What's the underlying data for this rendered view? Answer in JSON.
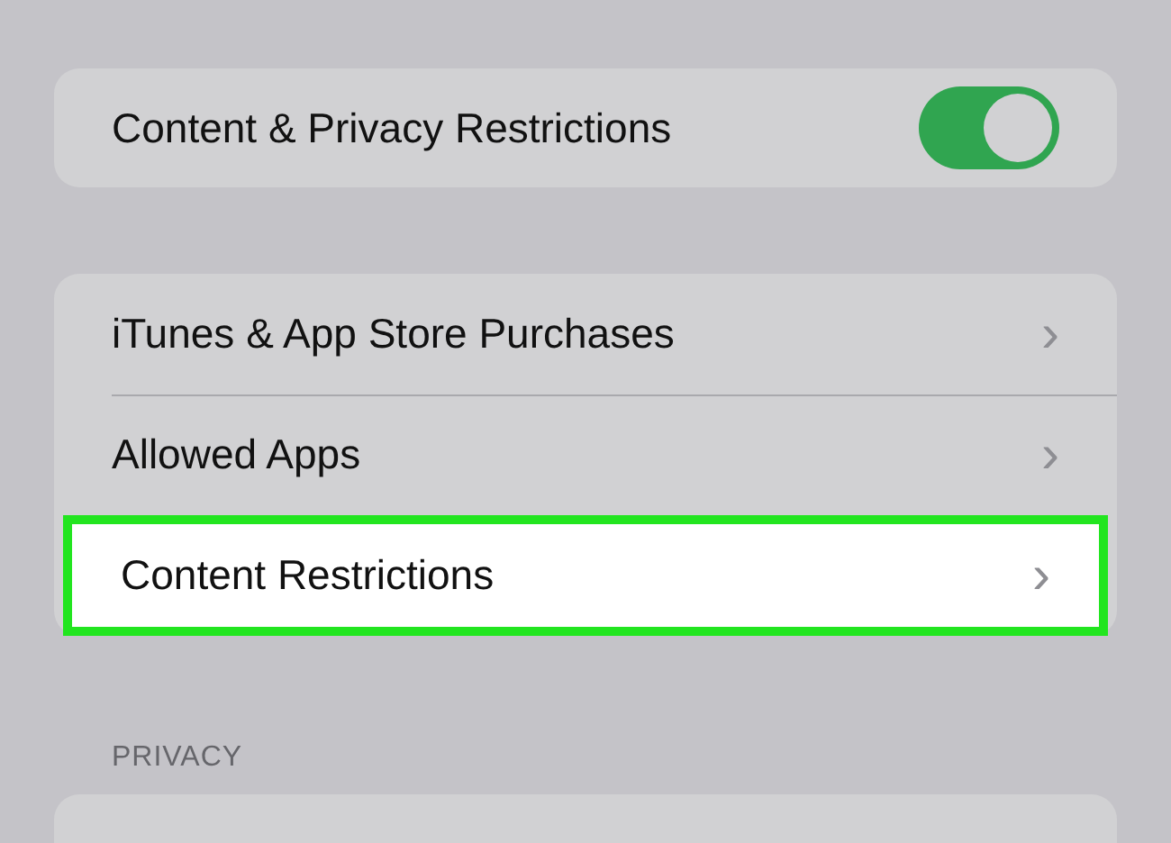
{
  "master_switch": {
    "label": "Content & Privacy Restrictions",
    "on": true
  },
  "menu_items": [
    {
      "label": "iTunes & App Store Purchases",
      "chevron": "›",
      "highlighted": false
    },
    {
      "label": "Allowed Apps",
      "chevron": "›",
      "highlighted": false
    },
    {
      "label": "Content Restrictions",
      "chevron": "›",
      "highlighted": true
    }
  ],
  "privacy_section": {
    "heading": "PRIVACY"
  }
}
